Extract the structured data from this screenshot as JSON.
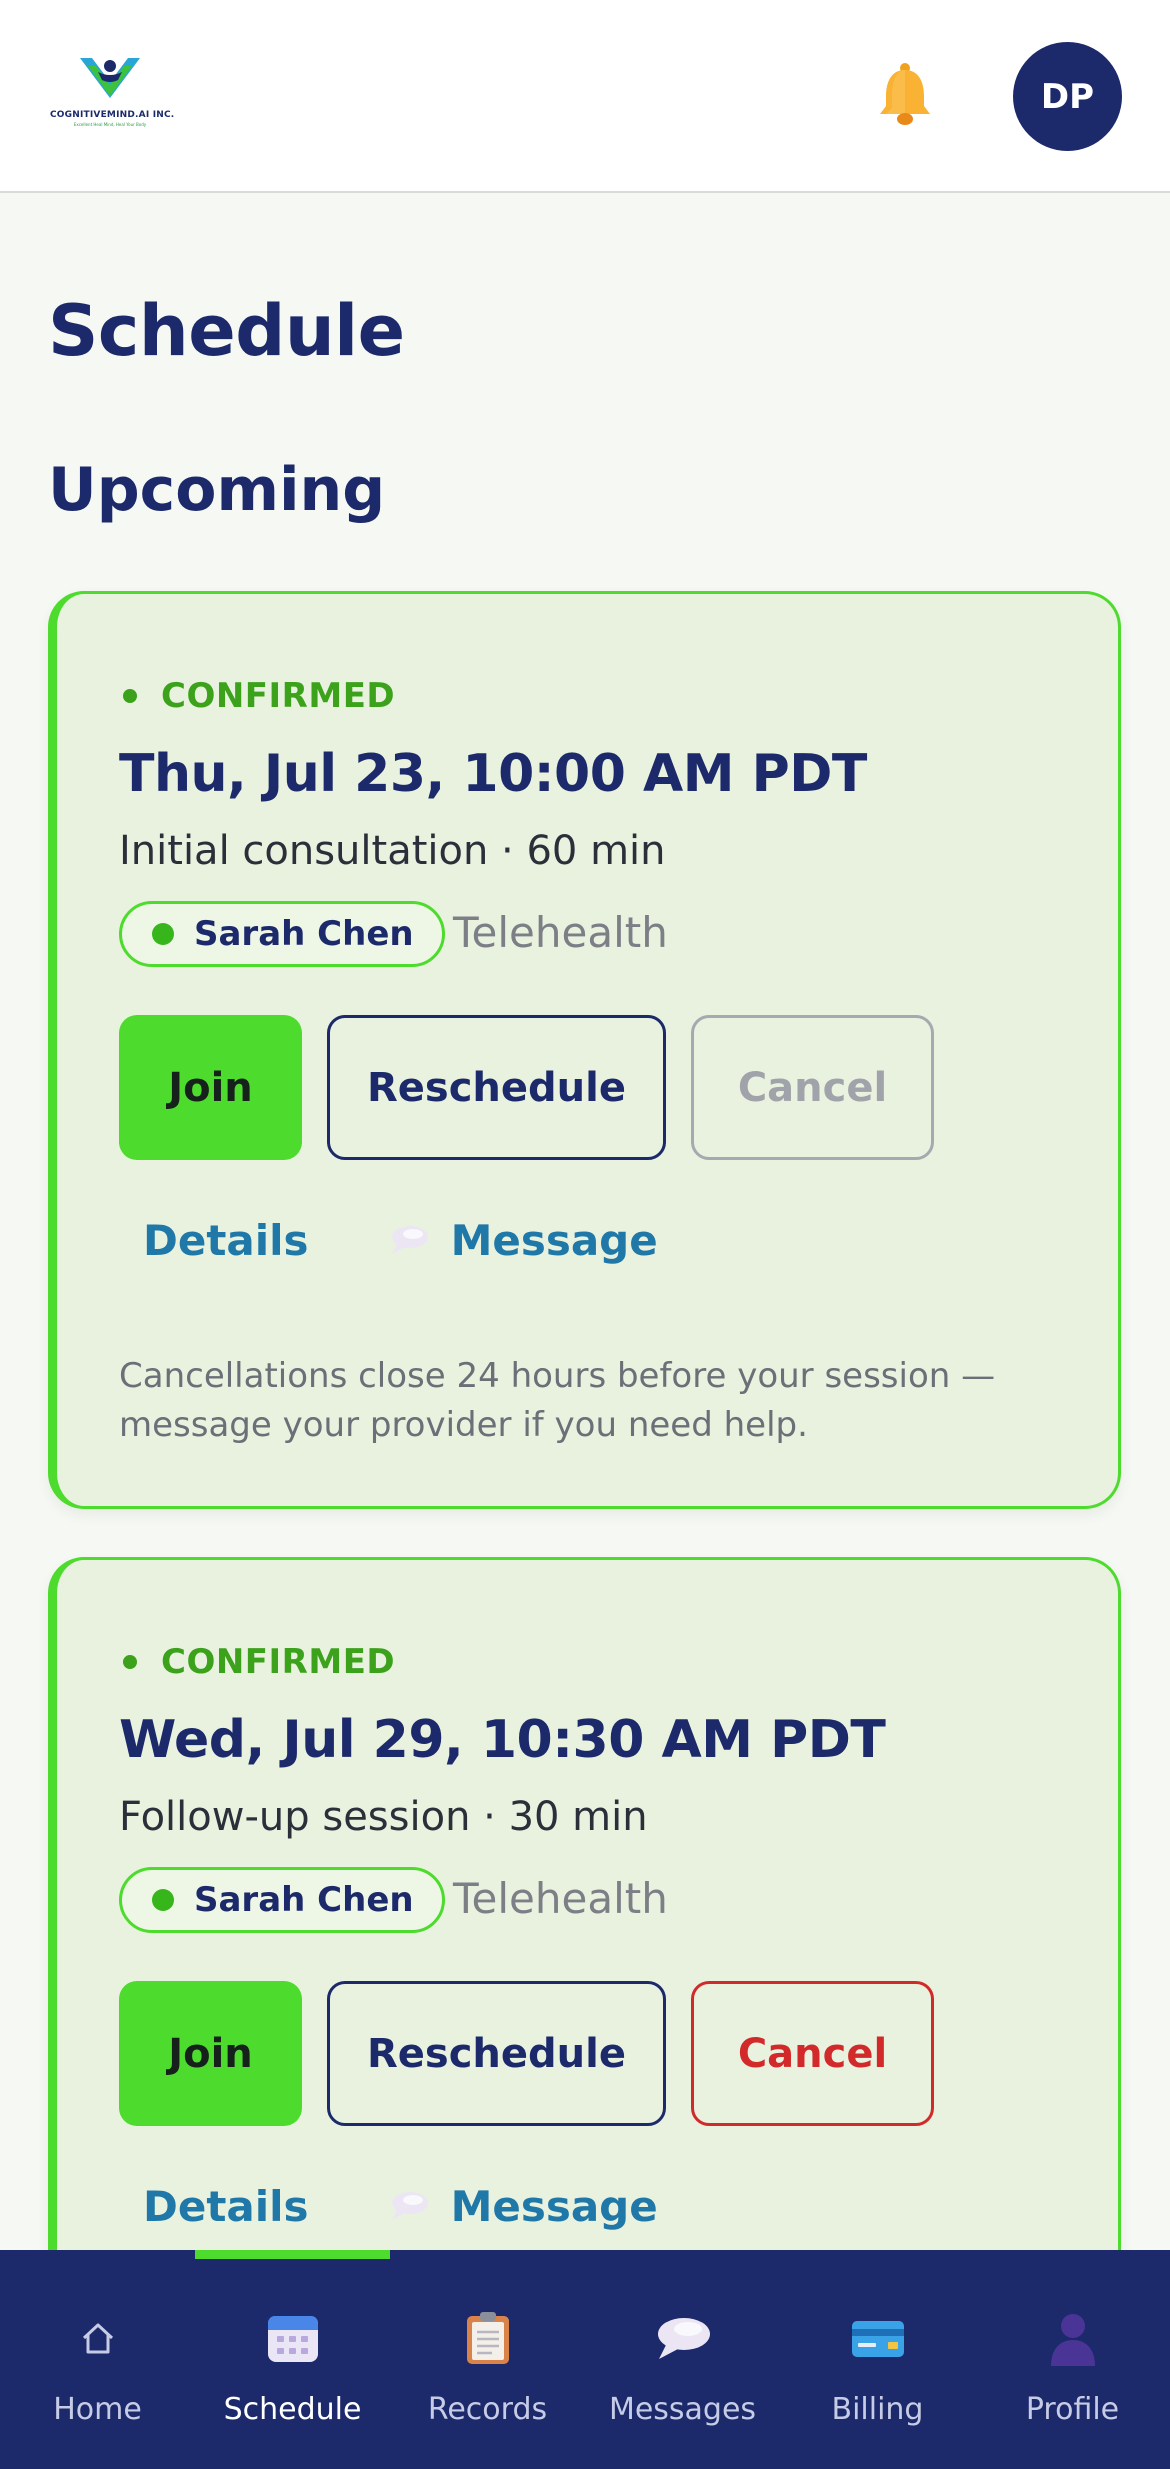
{
  "header": {
    "logo_text": "COGNITIVEMIND.AI INC.",
    "logo_tagline": "Excellent Heal Mind, Heal Your Body",
    "notification_icon": "bell-icon",
    "avatar_initials": "DP"
  },
  "page": {
    "title": "Schedule",
    "section_title": "Upcoming"
  },
  "appointments": [
    {
      "status": "CONFIRMED",
      "datetime": "Thu, Jul 23, 10:00 AM PDT",
      "description": "Initial consultation · 60 min",
      "provider": "Sarah Chen",
      "modality": "Telehealth",
      "join_label": "Join",
      "reschedule_label": "Reschedule",
      "cancel_label": "Cancel",
      "cancel_enabled": false,
      "details_label": "Details",
      "message_label": "Message",
      "note": "Cancellations close 24 hours before your session — message your provider if you need help."
    },
    {
      "status": "CONFIRMED",
      "datetime": "Wed, Jul 29, 10:30 AM PDT",
      "description": "Follow-up session · 30 min",
      "provider": "Sarah Chen",
      "modality": "Telehealth",
      "join_label": "Join",
      "reschedule_label": "Reschedule",
      "cancel_label": "Cancel",
      "cancel_enabled": true,
      "details_label": "Details",
      "message_label": "Message"
    }
  ],
  "colors": {
    "brand_navy": "#1c2a6b",
    "accent_green": "#4ddb2e",
    "status_green": "#3ca21c",
    "link_blue": "#1f78a8",
    "danger_red": "#d22a2a"
  },
  "bottom_nav": {
    "active": "Schedule",
    "items": [
      {
        "label": "Home",
        "icon": "home-icon"
      },
      {
        "label": "Schedule",
        "icon": "calendar-icon"
      },
      {
        "label": "Records",
        "icon": "clipboard-icon"
      },
      {
        "label": "Messages",
        "icon": "speech-bubble-icon"
      },
      {
        "label": "Billing",
        "icon": "credit-card-icon"
      },
      {
        "label": "Profile",
        "icon": "person-silhouette-icon"
      }
    ]
  }
}
